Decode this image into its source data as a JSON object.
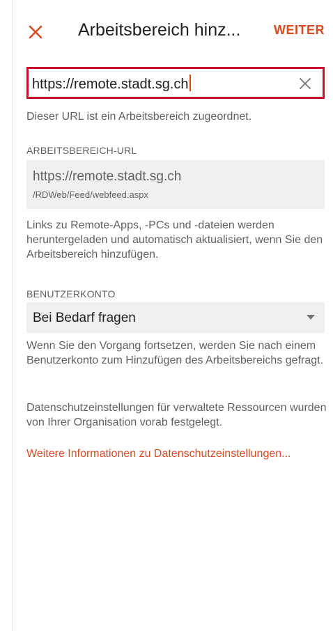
{
  "appbar": {
    "title": "Arbeitsbereich hinz...",
    "next_label": "WEITER",
    "close_icon": "close-icon",
    "accent_color": "#d84a21"
  },
  "url_input": {
    "value": "https://remote.stadt.sg.ch",
    "clear_icon": "clear-icon",
    "highlight_color": "#c8102e"
  },
  "url_hint": "Dieser URL ist ein Arbeitsbereich zugeordnet.",
  "workspace_url": {
    "label": "ARBEITSBEREICH-URL",
    "main": "https://remote.stadt.sg.ch",
    "path": "/RDWeb/Feed/webfeed.aspx"
  },
  "workspace_desc": "Links zu Remote-Apps, -PCs und -dateien werden heruntergeladen und automatisch aktualisiert, wenn Sie den Arbeitsbereich hinzufügen.",
  "account": {
    "label": "BENUTZERKONTO",
    "selected": "Bei Bedarf fragen",
    "dropdown_icon": "caret-down-icon",
    "desc": "Wenn Sie den Vorgang fortsetzen, werden Sie nach einem Benutzerkonto zum Hinzufügen des Arbeitsbereichs gefragt."
  },
  "privacy": {
    "desc": "Datenschutzeinstellungen für verwaltete Ressourcen wurden von Ihrer Organisation vorab festgelegt.",
    "link": "Weitere Informationen zu Datenschutzeinstellungen..."
  }
}
